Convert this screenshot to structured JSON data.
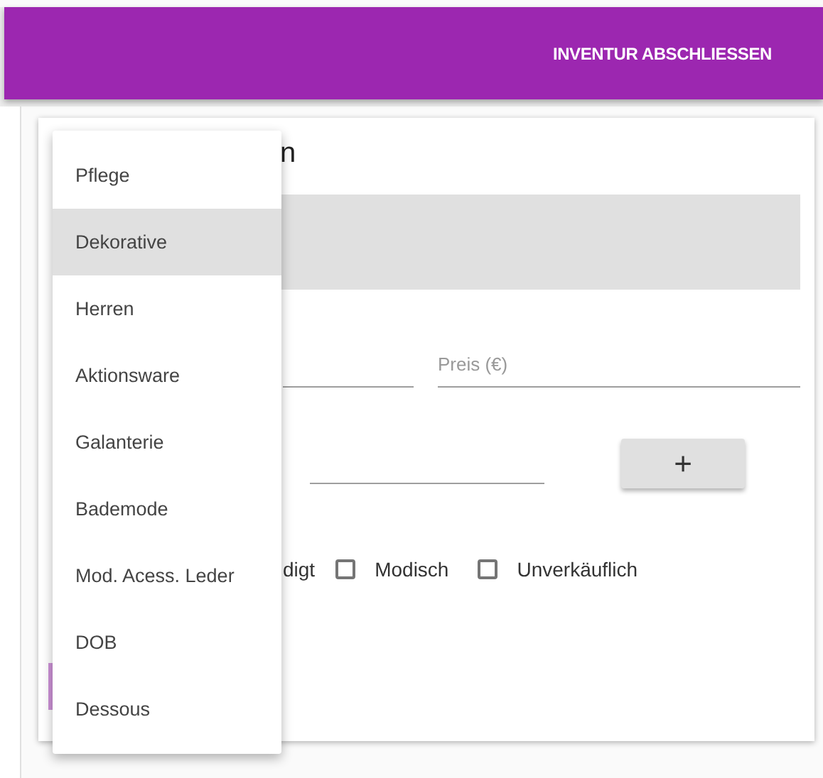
{
  "app_bar": {
    "action": "INVENTUR ABSCHLIESSEN"
  },
  "card": {
    "title": "n",
    "price_field": {
      "placeholder": "Preis (€)"
    },
    "add_button": {
      "label": "+"
    },
    "cut_label": "digt",
    "checkboxes": [
      {
        "label": "Modisch",
        "checked": false
      },
      {
        "label": "Unverkäuflich",
        "checked": false
      }
    ]
  },
  "menu": {
    "items": [
      {
        "label": "Pflege",
        "selected": false
      },
      {
        "label": "Dekorative",
        "selected": true
      },
      {
        "label": "Herren",
        "selected": false
      },
      {
        "label": "Aktionsware",
        "selected": false
      },
      {
        "label": "Galanterie",
        "selected": false
      },
      {
        "label": "Bademode",
        "selected": false
      },
      {
        "label": "Mod. Acess. Leder",
        "selected": false
      },
      {
        "label": "DOB",
        "selected": false
      },
      {
        "label": "Dessous",
        "selected": false
      }
    ]
  }
}
